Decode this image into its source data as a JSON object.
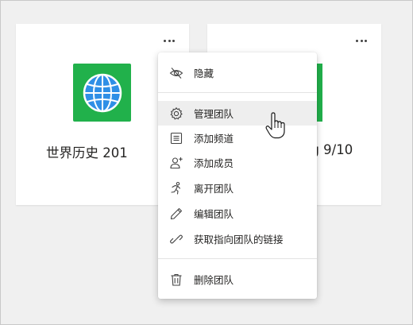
{
  "cards": [
    {
      "name": "世界历史 201",
      "tile_color": "#21b14b"
    },
    {
      "name": "ng 9/10",
      "tile_color": "#21b14b"
    }
  ],
  "menu": {
    "items": [
      {
        "label": "隐藏",
        "icon": "hidden-eye-icon"
      },
      {
        "label": "管理团队",
        "icon": "gear-icon",
        "hovered": true
      },
      {
        "label": "添加频道",
        "icon": "channel-list-icon"
      },
      {
        "label": "添加成员",
        "icon": "add-person-icon"
      },
      {
        "label": "离开团队",
        "icon": "running-person-icon"
      },
      {
        "label": "编辑团队",
        "icon": "pencil-icon"
      },
      {
        "label": "获取指向团队的链接",
        "icon": "link-icon"
      },
      {
        "label": "删除团队",
        "icon": "trash-icon"
      }
    ]
  },
  "colors": {
    "accent_green": "#21b14b",
    "globe_blue": "#2f8fe6"
  }
}
